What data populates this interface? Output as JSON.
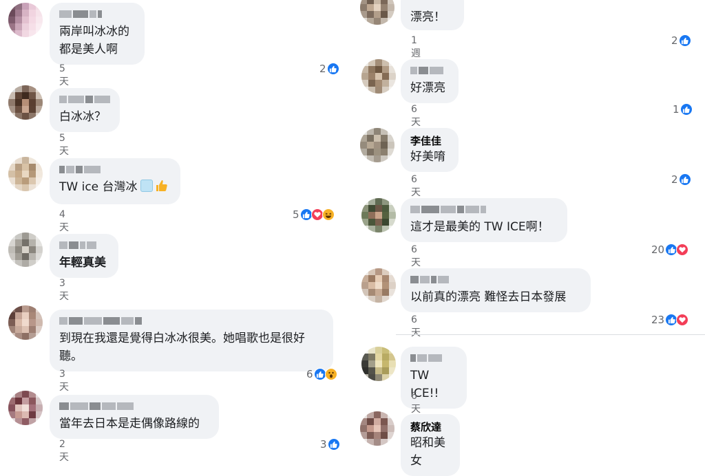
{
  "left": [
    {
      "text": "兩岸叫冰冰的\n都是美人啊",
      "time": "5天",
      "count": "2",
      "reactions": [
        "like"
      ]
    },
    {
      "text": "白冰冰？",
      "time": "5天",
      "count": "",
      "reactions": []
    },
    {
      "text": "TW ice 台灣冰",
      "emoji": [
        "ice-cube",
        "thumbs-up"
      ],
      "time": "4天",
      "count": "5",
      "reactions": [
        "like",
        "love",
        "haha"
      ]
    },
    {
      "text": "年輕真美",
      "time": "3天",
      "count": "",
      "reactions": []
    },
    {
      "text": "到現在我還是覺得白冰冰很美。她唱歌也是很好\n聽。",
      "time": "3天",
      "count": "6",
      "reactions": [
        "like",
        "wow"
      ]
    },
    {
      "text": "當年去日本是走偶像路線的",
      "time": "2天",
      "count": "3",
      "reactions": [
        "like"
      ]
    }
  ],
  "right": [
    {
      "text": "漂亮！",
      "time": "1週",
      "count": "2",
      "reactions": [
        "like"
      ]
    },
    {
      "text": "好漂亮",
      "time": "6天",
      "count": "1",
      "reactions": [
        "like"
      ]
    },
    {
      "name": "李佳佳",
      "text": "好美唷",
      "time": "6天",
      "count": "2",
      "reactions": [
        "like"
      ]
    },
    {
      "text": "這才是最美的 TW ICE啊！",
      "time": "6天",
      "count": "20",
      "reactions": [
        "like",
        "love"
      ]
    },
    {
      "text": "以前真的漂亮 難怪去日本發展",
      "time": "6天",
      "count": "23",
      "reactions": [
        "like",
        "love"
      ]
    },
    {
      "text": "TW ICE!!",
      "time": "6天",
      "count": "",
      "reactions": []
    },
    {
      "name": "蔡欣達",
      "text": "昭和美女",
      "time": "",
      "count": "",
      "reactions": []
    }
  ],
  "colors": {
    "like": "#1877f2",
    "love": "#f33e58",
    "haha": "#f7b125",
    "bubble": "#f0f2f5",
    "meta": "#65676b"
  }
}
